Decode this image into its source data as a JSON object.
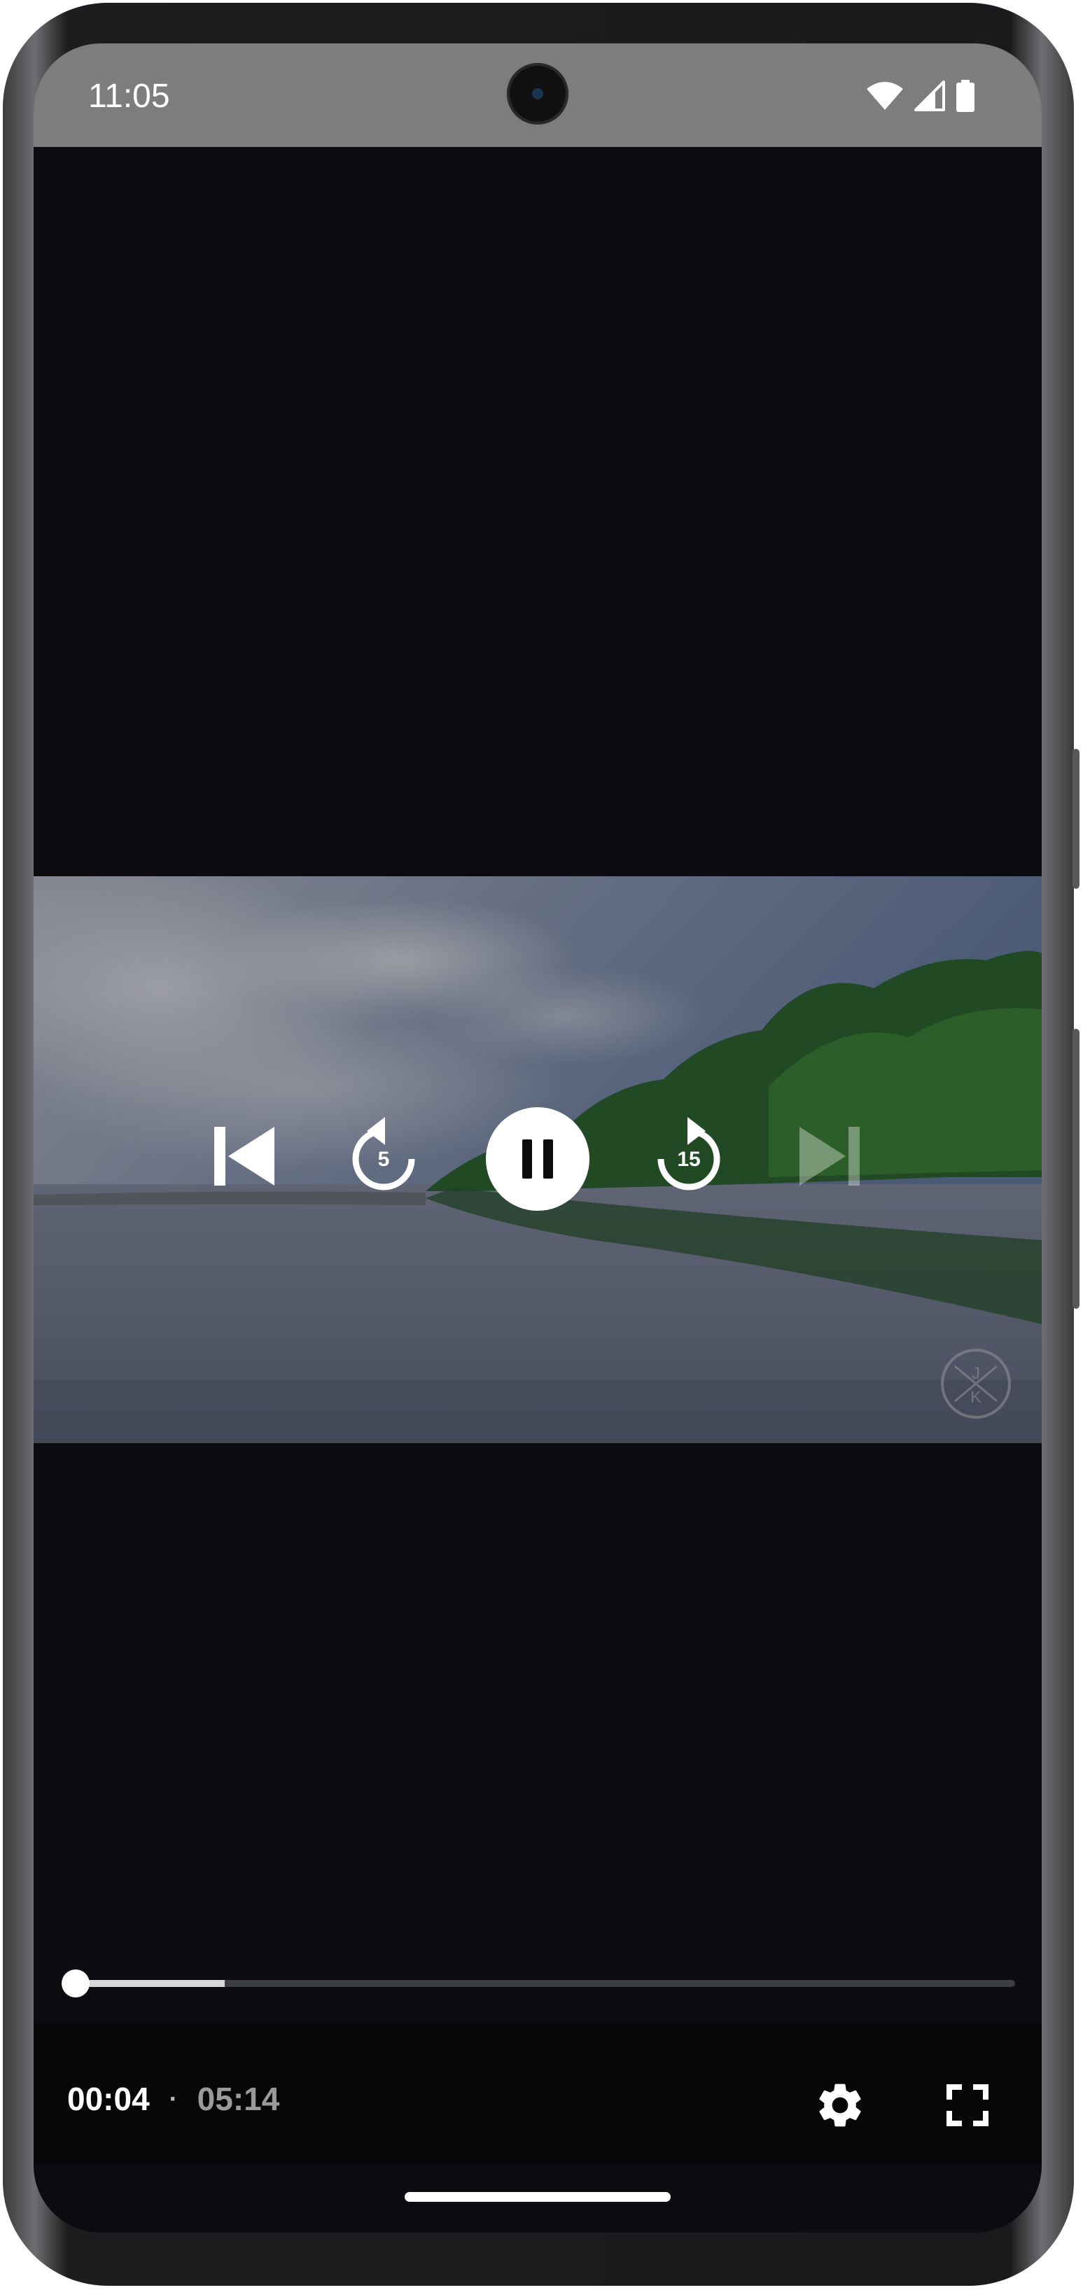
{
  "status_bar": {
    "time": "11:05",
    "icons": [
      "wifi-icon",
      "cell-signal-icon",
      "battery-icon"
    ]
  },
  "player": {
    "controls": {
      "previous_icon": "skip-previous-icon",
      "rewind_label": "5",
      "play_pause_icon": "pause-icon",
      "forward_label": "15",
      "next_icon": "skip-next-icon"
    },
    "watermark": "J K",
    "progress": {
      "played_fraction": 0.013,
      "buffered_fraction": 0.17
    },
    "time": {
      "current": "00:04",
      "separator": "·",
      "total": "05:14"
    },
    "actions": [
      "settings-icon",
      "fullscreen-icon"
    ]
  },
  "colors": {
    "status_bar_bg": "#7d7d7d",
    "screen_bg": "#0b0b10",
    "control_bar_bg": "#07070a",
    "accent": "#ffffff"
  }
}
